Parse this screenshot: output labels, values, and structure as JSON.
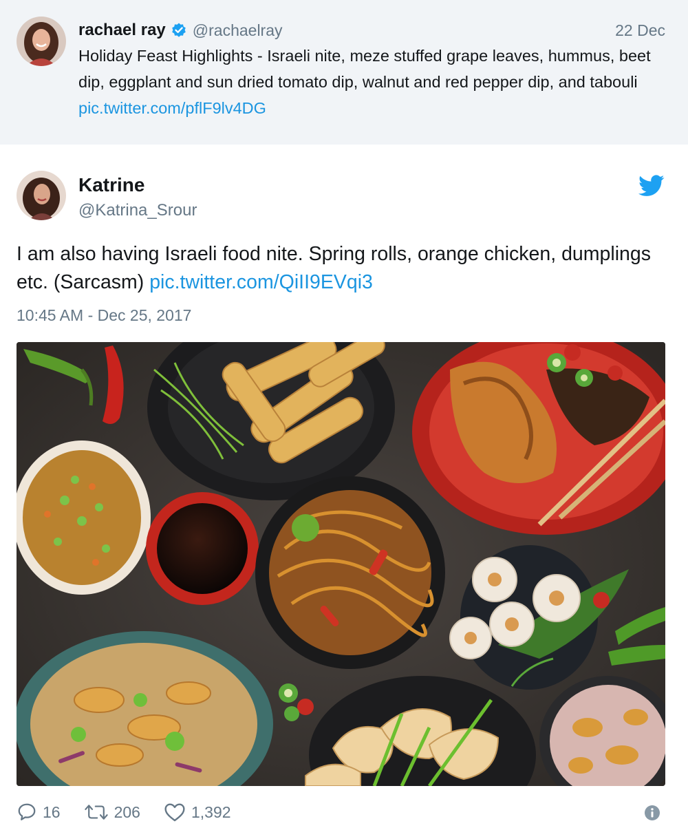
{
  "quoted_tweet": {
    "name": "rachael ray",
    "handle": "@rachaelray",
    "date": "22 Dec",
    "text": "Holiday Feast Highlights - Israeli nite, meze stuffed grape leaves, hummus, beet dip, eggplant and sun dried tomato dip, walnut and red pepper dip, and tabouli ",
    "link": "pic.twitter.com/pflF9lv4DG",
    "verified_icon": "verified-badge-icon"
  },
  "tweet": {
    "name": "Katrine",
    "handle": "@Katrina_Srour",
    "text": "I am also having Israeli food nite. Spring rolls, orange chicken, dumplings etc. (Sarcasm) ",
    "link": "pic.twitter.com/QiII9EVqi3",
    "timestamp": "10:45 AM - Dec 25, 2017",
    "brand_icon": "twitter-bird-icon",
    "photo": "asian-food-spread-photo"
  },
  "actions": {
    "replies": "16",
    "retweets": "206",
    "likes": "1,392"
  },
  "colors": {
    "link": "#1b95e0",
    "secondary_text": "#657786",
    "quoted_background": "#f1f4f7",
    "brand_blue": "#1da1f2"
  }
}
